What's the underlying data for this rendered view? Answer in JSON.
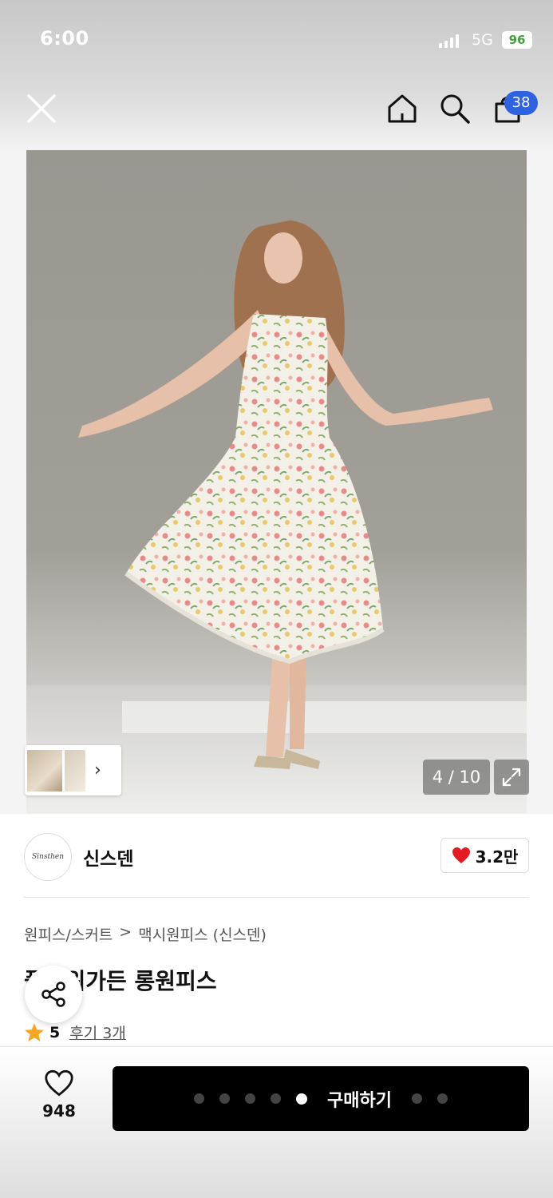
{
  "status_bar": {
    "time": "6:00",
    "network": "5G",
    "battery": "96"
  },
  "header": {
    "close_icon": "close-icon",
    "home_icon": "home-icon",
    "search_icon": "search-icon",
    "cart_icon": "shopping-bag-icon",
    "cart_count": "38",
    "badge_color": "#2e62e0"
  },
  "gallery": {
    "counter": "4 / 10",
    "expand_icon": "expand-icon",
    "thumb_arrow": "›"
  },
  "seller": {
    "logo_text": "Sinsthen",
    "name": "신스덴",
    "likes": "3.2만",
    "heart_color": "#e31b23"
  },
  "product": {
    "breadcrumb": [
      "원피스/스커트",
      ">",
      "맥시원피스 (신스덴)"
    ],
    "title": "플라워가든 롱원피스",
    "rating": "5",
    "reviews": "후기 3개",
    "star_color": "#f5a623"
  },
  "bottom": {
    "wish_count": "948",
    "buy_label": "구매하기",
    "dots_before": 5,
    "dots_after": 2
  }
}
